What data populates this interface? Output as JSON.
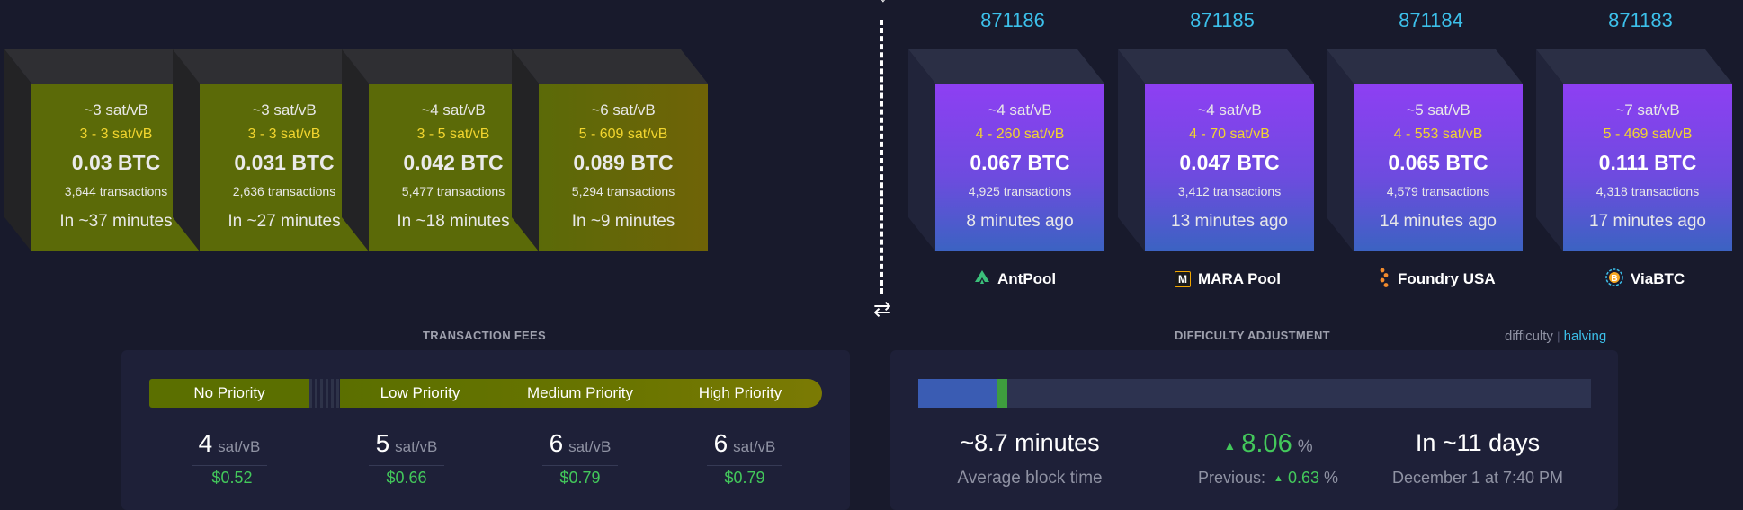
{
  "mempool_blocks": [
    {
      "median": "~3 sat/vB",
      "range": "3 - 3 sat/vB",
      "total": "0.03 BTC",
      "tx": "3,644 transactions",
      "eta": "In ~37 minutes"
    },
    {
      "median": "~3 sat/vB",
      "range": "3 - 3 sat/vB",
      "total": "0.031 BTC",
      "tx": "2,636 transactions",
      "eta": "In ~27 minutes"
    },
    {
      "median": "~4 sat/vB",
      "range": "3 - 5 sat/vB",
      "total": "0.042 BTC",
      "tx": "5,477 transactions",
      "eta": "In ~18 minutes"
    },
    {
      "median": "~6 sat/vB",
      "range": "5 - 609 sat/vB",
      "total": "0.089 BTC",
      "tx": "5,294 transactions",
      "eta": "In ~9 minutes"
    }
  ],
  "mined_blocks": [
    {
      "height": "871186",
      "median": "~4 sat/vB",
      "range": "4 - 260 sat/vB",
      "total": "0.067 BTC",
      "tx": "4,925 transactions",
      "time": "8 minutes ago",
      "pool": "AntPool",
      "pool_icon": "antpool-icon"
    },
    {
      "height": "871185",
      "median": "~4 sat/vB",
      "range": "4 - 70 sat/vB",
      "total": "0.047 BTC",
      "tx": "3,412 transactions",
      "time": "13 minutes ago",
      "pool": "MARA Pool",
      "pool_icon": "mara-pool-icon",
      "pool_icon_text": "M"
    },
    {
      "height": "871184",
      "median": "~5 sat/vB",
      "range": "4 - 553 sat/vB",
      "total": "0.065 BTC",
      "tx": "4,579 transactions",
      "time": "14 minutes ago",
      "pool": "Foundry USA",
      "pool_icon": "foundry-usa-icon"
    },
    {
      "height": "871183",
      "median": "~7 sat/vB",
      "range": "5 - 469 sat/vB",
      "total": "0.111 BTC",
      "tx": "4,318 transactions",
      "time": "17 minutes ago",
      "pool": "ViaBTC",
      "pool_icon": "viabtc-icon"
    }
  ],
  "fees": {
    "title": "TRANSACTION FEES",
    "priorities": [
      "No Priority",
      "Low Priority",
      "Medium Priority",
      "High Priority"
    ],
    "values": [
      {
        "rate": "4",
        "unit": "sat/vB",
        "usd": "$0.52"
      },
      {
        "rate": "5",
        "unit": "sat/vB",
        "usd": "$0.66"
      },
      {
        "rate": "6",
        "unit": "sat/vB",
        "usd": "$0.79"
      },
      {
        "rate": "6",
        "unit": "sat/vB",
        "usd": "$0.79"
      }
    ]
  },
  "difficulty": {
    "title": "DIFFICULTY ADJUSTMENT",
    "toggle": {
      "difficulty": "difficulty",
      "separator": "|",
      "halving": "halving"
    },
    "epoch_progress": 0.12,
    "extra_progress": 0.015,
    "avg_block_time": "~8.7 minutes",
    "avg_block_time_label": "Average block time",
    "change": "8.06",
    "change_unit": "%",
    "previous_label": "Previous:",
    "previous_change": "0.63",
    "previous_unit": "%",
    "eta": "In ~11 days",
    "eta_date": "December 1 at 7:40 PM"
  },
  "colors": {
    "accent_blue": "#3cc0ea",
    "fee_green": "#43c85b",
    "range_yellow": "#f2d52e",
    "purple": "#8e3ff3"
  },
  "icons": {
    "divider_top": "↕",
    "swap": "⇄"
  }
}
